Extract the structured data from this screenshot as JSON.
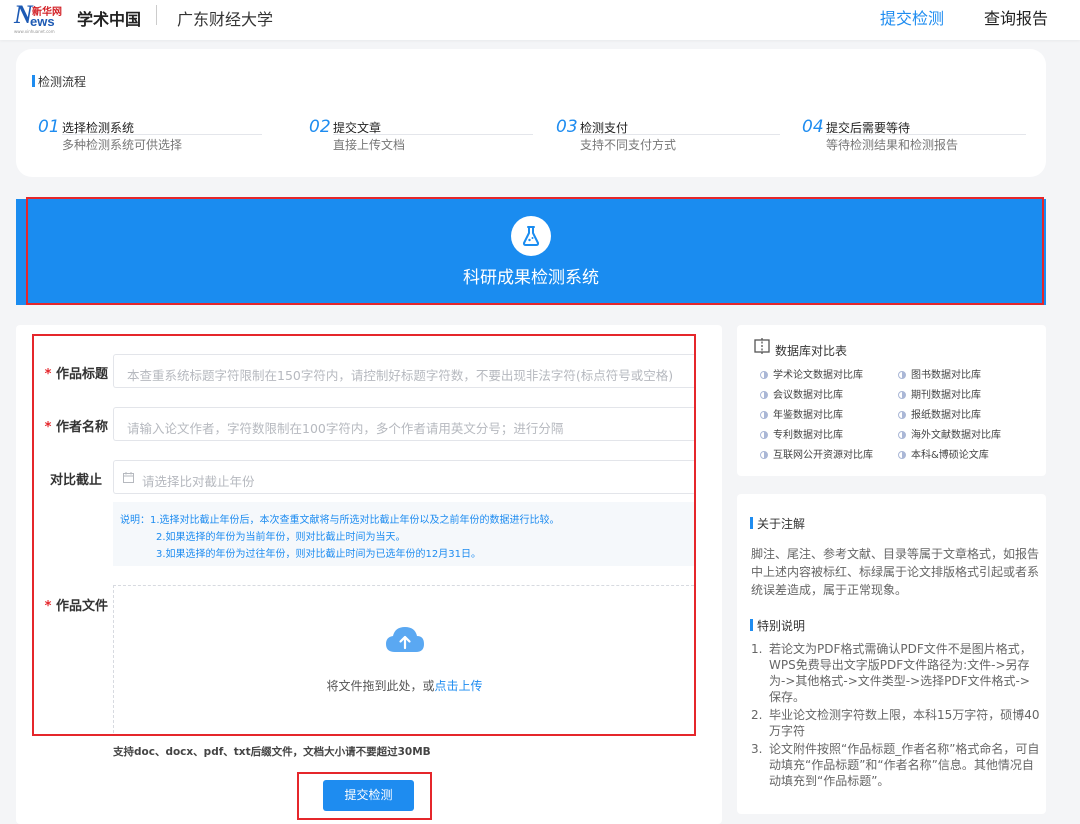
{
  "header": {
    "logo_top": "新华网",
    "logo_n": "N",
    "logo_ews": "ews",
    "logo_url": "www.xinhuanet.com",
    "brand": "学术中国",
    "school": "广东财经大学",
    "nav_submit": "提交检测",
    "nav_query": "查询报告"
  },
  "process": {
    "title": "检测流程",
    "steps": [
      {
        "num": "01",
        "title": "选择检测系统",
        "desc": "多种检测系统可供选择"
      },
      {
        "num": "02",
        "title": "提交文章",
        "desc": "直接上传文档"
      },
      {
        "num": "03",
        "title": "检测支付",
        "desc": "支持不同支付方式"
      },
      {
        "num": "04",
        "title": "提交后需要等待",
        "desc": "等待检测结果和检测报告"
      }
    ]
  },
  "banner": {
    "title": "科研成果检测系统",
    "icon": "flask-icon"
  },
  "form": {
    "title_label": "作品标题",
    "title_placeholder": "本查重系统标题字符限制在150字符内，请控制好标题字符数，不要出现非法字符(标点符号或空格)",
    "author_label": "作者名称",
    "author_placeholder": "请输入论文作者，字符数限制在100字符内，多个作者请用英文分号；进行分隔",
    "year_label": "对比截止",
    "year_placeholder": "请选择比对截止年份",
    "note_lines": [
      "说明：1.选择对比截止年份后，本次查重文献将与所选对比截止年份以及之前年份的数据进行比较。",
      "2.如果选择的年份为当前年份，则对比截止时间为当天。",
      "3.如果选择的年份为过往年份，则对比截止时间为已选年份的12月31日。"
    ],
    "file_label": "作品文件",
    "upload_text": "将文件拖到此处，或",
    "upload_link": "点击上传",
    "hint": "支持doc、docx、pdf、txt后缀文件，文档大小请不要超过30MB",
    "submit": "提交检测"
  },
  "db": {
    "title": "数据库对比表",
    "items": [
      "学术论文数据对比库",
      "图书数据对比库",
      "会议数据对比库",
      "期刊数据对比库",
      "年鉴数据对比库",
      "报纸数据对比库",
      "专利数据对比库",
      "海外文献数据对比库",
      "互联网公开资源对比库",
      "本科&博硕论文库"
    ]
  },
  "info": {
    "h1": "关于注解",
    "p1": "脚注、尾注、参考文献、目录等属于文章格式，如报告中上述内容被标红、标绿属于论文排版格式引起或者系统误差造成，属于正常现象。",
    "h2": "特别说明",
    "list": [
      {
        "n": "1.",
        "text": "若论文为PDF格式需确认PDF文件不是图片格式，WPS免费导出文字版PDF文件路径为:文件->另存为->其他格式->文件类型->选择PDF文件格式->保存。"
      },
      {
        "n": "2.",
        "text": "毕业论文检测字符数上限，本科15万字符，硕博40万字符"
      },
      {
        "n": "3.",
        "text": "论文附件按照“作品标题_作者名称”格式命名，可自动填充“作品标题”和“作者名称”信息。其他情况自动填充到“作品标题”。"
      }
    ]
  },
  "colors": {
    "accent": "#1e8cf0",
    "highlight": "#e5262b"
  }
}
